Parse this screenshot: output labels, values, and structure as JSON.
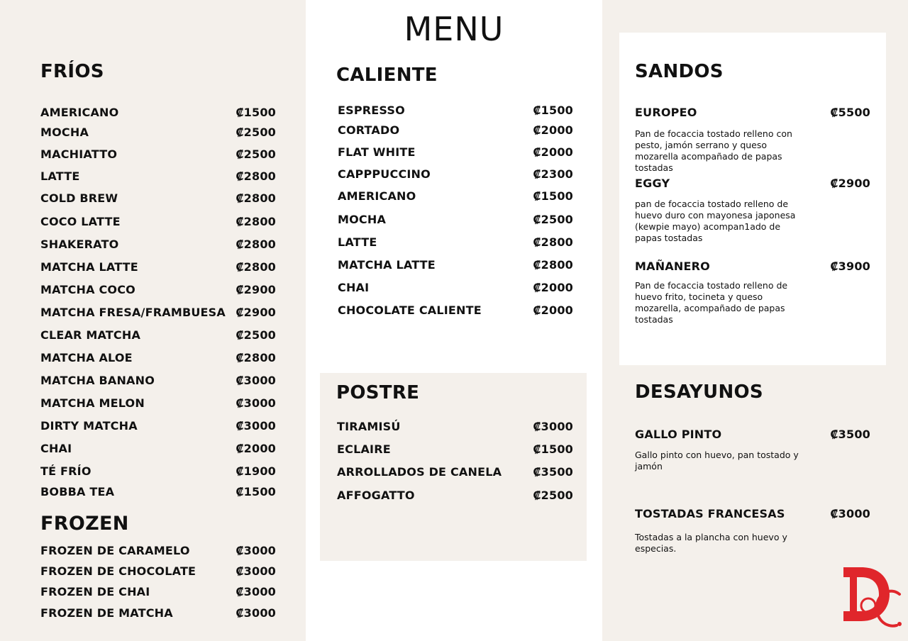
{
  "menu_title": "MENU",
  "frios": {
    "title": "FRÍOS",
    "items": [
      {
        "name": "AMERICANO",
        "price": "₡1500"
      },
      {
        "name": "MOCHA",
        "price": "₡2500"
      },
      {
        "name": "MACHIATTO",
        "price": "₡2500"
      },
      {
        "name": "LATTE",
        "price": "₡2800"
      },
      {
        "name": "COLD BREW",
        "price": "₡2800"
      },
      {
        "name": "COCO LATTE",
        "price": "₡2800"
      },
      {
        "name": "SHAKERATO",
        "price": "₡2800"
      },
      {
        "name": "MATCHA LATTE",
        "price": "₡2800"
      },
      {
        "name": "MATCHA COCO",
        "price": "₡2900"
      },
      {
        "name": "MATCHA FRESA/FRAMBUESA",
        "price": "₡2900"
      },
      {
        "name": "CLEAR MATCHA",
        "price": "₡2500"
      },
      {
        "name": "MATCHA ALOE",
        "price": "₡2800"
      },
      {
        "name": "MATCHA BANANO",
        "price": "₡3000"
      },
      {
        "name": "MATCHA MELON",
        "price": "₡3000"
      },
      {
        "name": "DIRTY MATCHA",
        "price": "₡3000"
      },
      {
        "name": "CHAI",
        "price": "₡2000"
      },
      {
        "name": "TÉ FRÍO",
        "price": "₡1900"
      },
      {
        "name": "BOBBA TEA",
        "price": "₡1500"
      }
    ]
  },
  "frozen": {
    "title": "FROZEN",
    "items": [
      {
        "name": "FROZEN DE CARAMELO",
        "price": "₡3000"
      },
      {
        "name": "FROZEN DE CHOCOLATE",
        "price": "₡3000"
      },
      {
        "name": "FROZEN DE CHAI",
        "price": "₡3000"
      },
      {
        "name": "FROZEN DE MATCHA",
        "price": "₡3000"
      }
    ]
  },
  "caliente": {
    "title": "CALIENTE",
    "items": [
      {
        "name": "ESPRESSO",
        "price": "₡1500"
      },
      {
        "name": "CORTADO",
        "price": "₡2000"
      },
      {
        "name": "FLAT WHITE",
        "price": "₡2000"
      },
      {
        "name": "CAPPPUCCINO",
        "price": "₡2300"
      },
      {
        "name": "AMERICANO",
        "price": "₡1500"
      },
      {
        "name": "MOCHA",
        "price": "₡2500"
      },
      {
        "name": "LATTE",
        "price": "₡2800"
      },
      {
        "name": "MATCHA LATTE",
        "price": "₡2800"
      },
      {
        "name": "CHAI",
        "price": "₡2000"
      },
      {
        "name": "CHOCOLATE CALIENTE",
        "price": "₡2000"
      }
    ]
  },
  "postre": {
    "title": "POSTRE",
    "items": [
      {
        "name": "TIRAMISÚ",
        "price": "₡3000"
      },
      {
        "name": "ECLAIRE",
        "price": "₡1500"
      },
      {
        "name": "ARROLLADOS DE CANELA",
        "price": "₡3500"
      },
      {
        "name": "AFFOGATTO",
        "price": "₡2500"
      }
    ]
  },
  "sandos": {
    "title": "SANDOS",
    "items": [
      {
        "name": "EUROPEO",
        "price": "₡5500",
        "desc": "Pan de focaccia tostado relleno con pesto, jamón serrano y queso mozarella acompañado de papas tostadas"
      },
      {
        "name": "EGGY",
        "price": "₡2900",
        "desc": "pan de focaccia tostado relleno de huevo duro con mayonesa japonesa (kewpie mayo) acompan1ado de papas tostadas"
      },
      {
        "name": "MAÑANERO",
        "price": "₡3900",
        "desc": "Pan de focaccia tostado relleno de huevo frito, tocineta y queso mozarella, acompañado de papas tostadas"
      }
    ]
  },
  "desayunos": {
    "title": "DESAYUNOS",
    "items": [
      {
        "name": "GALLO PINTO",
        "price": "₡3500",
        "desc": "Gallo pinto con huevo, pan tostado y jamón"
      },
      {
        "name": "TOSTADAS FRANCESAS",
        "price": "₡3000",
        "desc": "Tostadas a la plancha con huevo y especias."
      }
    ]
  },
  "logo": {
    "text": "DC",
    "color": "#e0262b"
  }
}
